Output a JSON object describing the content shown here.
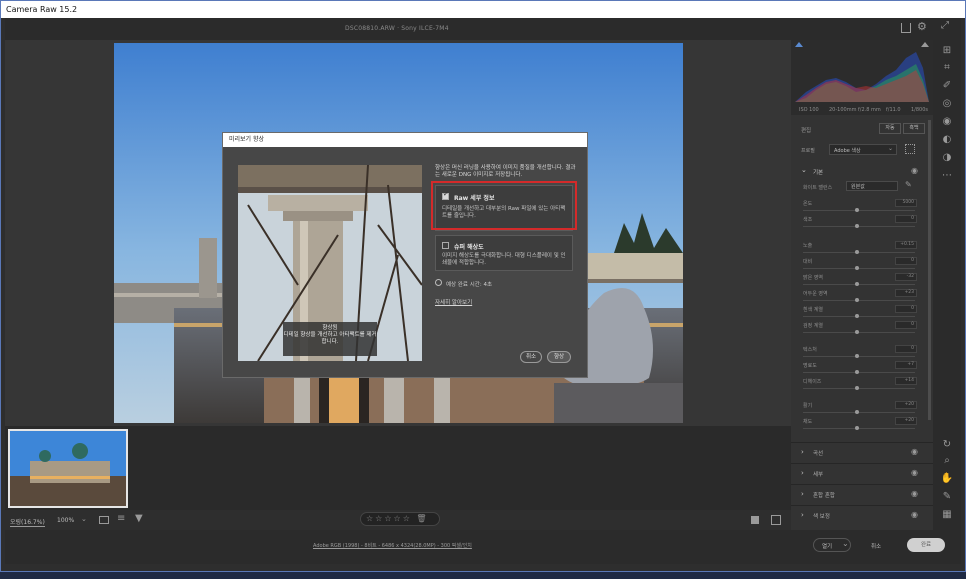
{
  "window": {
    "title": "Camera Raw 15.2"
  },
  "topbar": {
    "filename": "DSC08810.ARW · Sony ILCE-7M4"
  },
  "modal": {
    "title": "미리보기 향상",
    "intro": "향상은 머신 러닝을 사용하여 이미지 품질을 개선합니다. 결과는 새로운 DNG 이미지로 저장됩니다.",
    "preview_caption": "향상됨\n디테일 향상을 개선하고 아티팩트를 제거합니다.",
    "raw_option": {
      "title": "Raw 세부 정보",
      "desc": "디테일을 개선하고 대부분의 Raw 파일에 있는 아티팩트를 줄입니다.",
      "checked": true
    },
    "super_option": {
      "title": "슈퍼 해상도",
      "desc": "이미지 해상도를 극대화합니다. 대형 디스플레이 및 인쇄물에 적합합니다.",
      "checked": false
    },
    "estimate": "예상 완료 시간: 4초",
    "learn_more": "자세히 알아보기",
    "cancel_label": "취소",
    "enhance_label": "향상"
  },
  "statusbar": {
    "zoom_fit": "오링(16.7%)",
    "zoom": "100%"
  },
  "bottombar": {
    "info": "Adobe RGB (1998) - 8비트 - 6486 x 4324(28.0MP) - 300 픽셀/인치",
    "open_label": "열기",
    "cancel_label": "취소",
    "done_label": "완료"
  },
  "panel": {
    "exif": [
      "ISO 100",
      "20-100mm f/2.8 mm",
      "f/11.0",
      "1/800s"
    ],
    "edit_label": "편집",
    "auto_label": "자동",
    "bw_label": "흑백",
    "profile_label": "프로필",
    "profile_value": "Adobe 색상",
    "basic_label": "기본",
    "wb_label": "화이트 밸런스",
    "wb_value": "원본값",
    "sliders": [
      {
        "label": "온도",
        "value": "5000"
      },
      {
        "label": "색조",
        "value": "0"
      },
      {
        "label": "노출",
        "value": "+0.15"
      },
      {
        "label": "대비",
        "value": "0"
      },
      {
        "label": "밝은 영역",
        "value": "-32"
      },
      {
        "label": "어두운 영역",
        "value": "+23"
      },
      {
        "label": "흰색 계열",
        "value": "0"
      },
      {
        "label": "검정 계열",
        "value": "0"
      },
      {
        "label": "텍스처",
        "value": "0"
      },
      {
        "label": "명료도",
        "value": "+7"
      },
      {
        "label": "디헤이즈",
        "value": "+14"
      },
      {
        "label": "활기",
        "value": "+20"
      },
      {
        "label": "채도",
        "value": "+20"
      }
    ],
    "sections": [
      "곡선",
      "세부",
      "혼합 혼합",
      "색 보정"
    ]
  },
  "colors": {
    "accent": "#d42a2a",
    "window_border": "#5a78b8",
    "background": "#2e2e2e"
  }
}
